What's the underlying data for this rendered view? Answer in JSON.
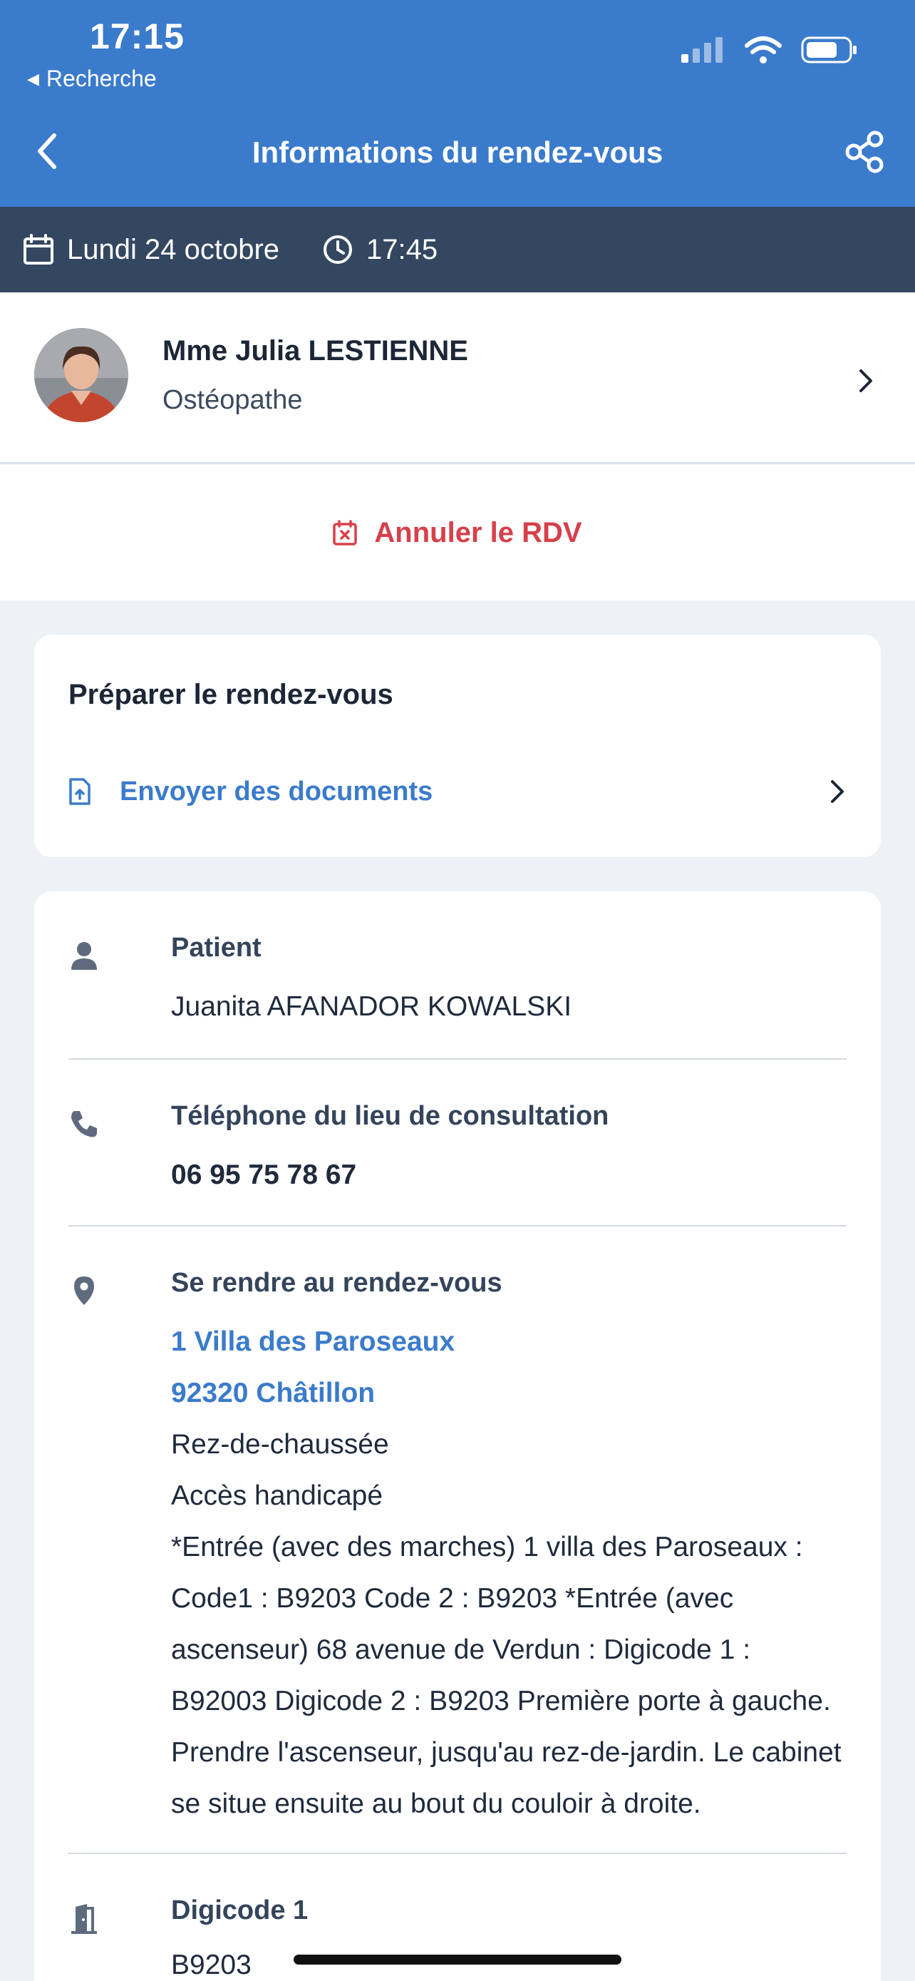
{
  "status_bar": {
    "time": "17:15",
    "back_app": "Recherche"
  },
  "nav": {
    "title": "Informations du rendez-vous"
  },
  "appointment": {
    "date": "Lundi 24 octobre",
    "time": "17:45"
  },
  "practitioner": {
    "name": "Mme Julia LESTIENNE",
    "specialty": "Ostéopathe"
  },
  "cancel": {
    "label": "Annuler le RDV"
  },
  "prepare": {
    "title": "Préparer le rendez-vous",
    "send_documents": "Envoyer des documents"
  },
  "patient": {
    "title": "Patient",
    "name": "Juanita AFANADOR KOWALSKI"
  },
  "phone": {
    "title": "Téléphone du lieu de consultation",
    "number": "06 95 75 78 67"
  },
  "location": {
    "title": "Se rendre au rendez-vous",
    "address_line1": "1 Villa des Paroseaux",
    "address_line2": "92320 Châtillon",
    "floor": "Rez-de-chaussée",
    "accessibility": "Accès handicapé",
    "directions": "*Entrée (avec des marches) 1 villa des Paroseaux : Code1 : B9203 Code 2 : B9203 *Entrée (avec ascenseur) 68 avenue de Verdun : Digicode 1 : B92003 Digicode 2 : B9203 Première porte à gauche. Prendre l'ascenseur, jusqu'au rez-de-jardin. Le cabinet se situe ensuite au bout du couloir à droite."
  },
  "digicode": {
    "title": "Digicode 1",
    "value": "B9203"
  },
  "colors": {
    "primary": "#3b7bcb",
    "datebar": "#344760",
    "danger": "#d6404a",
    "background": "#eef2f6"
  }
}
